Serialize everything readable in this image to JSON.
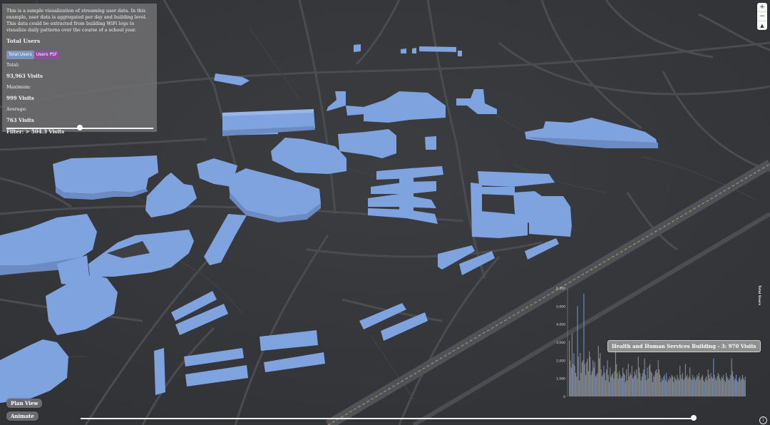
{
  "panel": {
    "description": "This is a sample visualization of streaming user data. In this example, user data is aggregated per day and building level. This data could be extracted from building WiFi logs to visualize daily patterns over the course of a school year.",
    "title": "Total Users",
    "tabs": [
      "Total Users",
      "Users PSF"
    ],
    "total_label": "Total:",
    "total_value": "93,963 Visits",
    "max_label": "Maximum:",
    "max_value": "999 Visits",
    "avg_label": "Average:",
    "avg_value": "763 Visits",
    "filter": "Filter: > 504.3 Visits",
    "filter_fraction": 0.5
  },
  "nav": {
    "zoom_in": "+",
    "zoom_out": "−",
    "compass": "▲"
  },
  "buttons": {
    "plan_view": "Plan View",
    "animate": "Animate"
  },
  "time_slider": {
    "fraction": 1.0
  },
  "tooltip": "Health and Human Services Building - 3: 970 Visits",
  "info_icon": "i",
  "colors": {
    "building": "#7fa3df",
    "background": "#34363a",
    "road": "#46484c",
    "bar_gray": "#9a9a9a",
    "bar_blue": "#6f8fc4",
    "highlight": "#e3d7b3"
  },
  "chart_data": {
    "type": "bar",
    "ylabel": "Total Users",
    "ylim": [
      0,
      6000
    ],
    "yticks": [
      "0",
      "1,000",
      "2,000",
      "3,000",
      "4,000",
      "5,000",
      "6,000"
    ],
    "series": [
      {
        "values": [
          3100,
          2000,
          1600,
          3500,
          1800,
          2400,
          1700,
          1300,
          1100,
          5000,
          2200,
          900,
          2400,
          1300,
          1900,
          2000,
          5700,
          1800,
          1200,
          1900,
          2100,
          1400,
          2500,
          2200,
          1200,
          1400,
          2000,
          1600,
          1900,
          1100,
          1200,
          1300,
          2800,
          2100,
          2400,
          1500,
          1100,
          1200,
          1700,
          1300,
          900,
          1500,
          2000,
          1200,
          800,
          1600,
          1100,
          1200,
          1300,
          1000,
          1400,
          2600,
          1800,
          1300,
          1000,
          1400,
          1200,
          1000,
          1100,
          1600,
          1300,
          1200,
          800,
          1500,
          900,
          1800,
          1100,
          1300,
          1200,
          1700,
          1000,
          1100,
          1400,
          1200,
          1500,
          1000,
          2200,
          1600,
          1300,
          900,
          1100,
          1300,
          1500,
          2100,
          1200,
          900,
          1600,
          1000,
          1700,
          1800,
          1400,
          1300,
          800,
          1100,
          1200,
          1400,
          1500,
          1300,
          2000,
          1500,
          1200,
          800,
          1000,
          900,
          1100,
          1200,
          900,
          1300,
          800,
          1000,
          900,
          1100,
          1000,
          1200,
          1100,
          800,
          1100,
          1000,
          900,
          1200,
          1000,
          900,
          1700,
          1200,
          1000,
          1300,
          900,
          1000,
          1800,
          1100,
          1200,
          1000,
          1100,
          1600,
          1000,
          900,
          1200,
          1000,
          1100,
          900,
          1000,
          1200,
          1100,
          1300,
          900,
          1000,
          1100,
          1200,
          900,
          800,
          1000,
          1100,
          900,
          1500,
          1200,
          1000,
          1300,
          1100,
          1000,
          2100,
          1200,
          1000,
          900,
          1100,
          1300,
          1200,
          1000,
          900,
          1100,
          1000,
          1200,
          900,
          800,
          1300,
          1100,
          1000,
          900,
          1000,
          1200,
          2100,
          1400,
          1100,
          900,
          1000,
          1200,
          900,
          800,
          1000,
          1100,
          900,
          1000,
          1200,
          1000,
          900,
          1100
        ]
      }
    ]
  }
}
